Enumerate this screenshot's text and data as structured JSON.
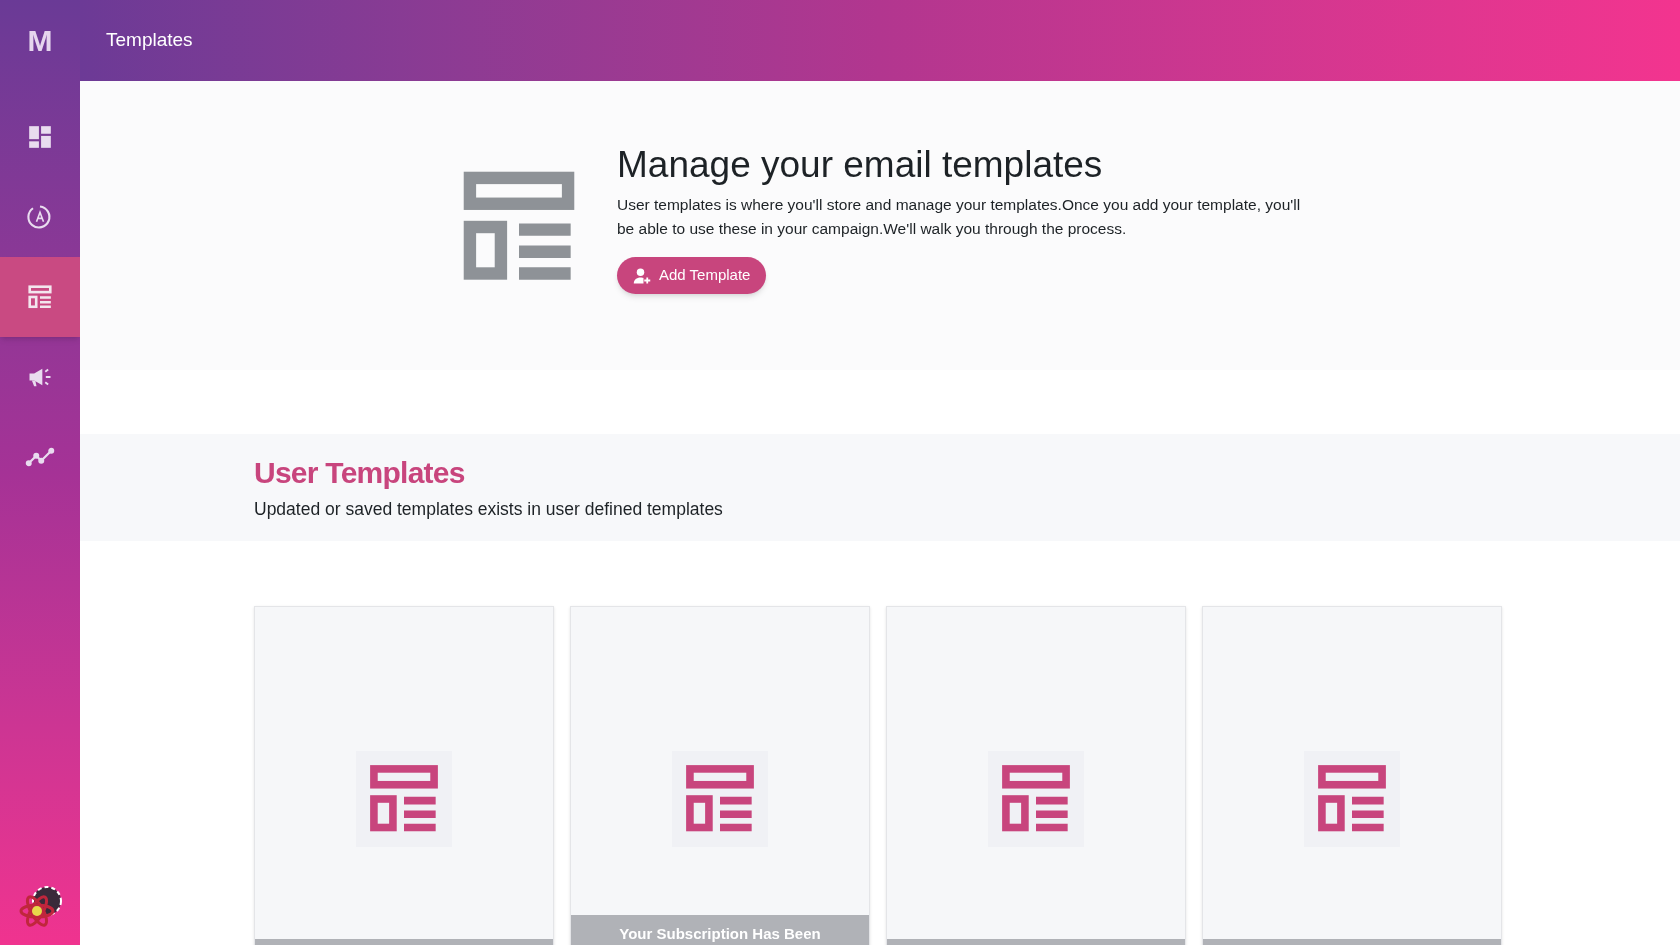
{
  "logo": "M",
  "header": {
    "title": "Templates"
  },
  "sidebar": {
    "items": [
      {
        "selected": false
      },
      {
        "selected": false
      },
      {
        "selected": true
      },
      {
        "selected": false
      },
      {
        "selected": false
      }
    ]
  },
  "hero": {
    "title": "Manage your email templates",
    "description": "User templates is where you'll store and manage your templates.Once you add your template, you'll be able to use these in your campaign.We'll walk you through the process.",
    "button": "Add Template"
  },
  "section": {
    "title": "User Templates",
    "subtitle": "Updated or saved templates exists in user defined templates"
  },
  "cards": [
    {
      "kind": "plain"
    },
    {
      "kind": "captioned",
      "caption": "Your Subscription Has Been"
    },
    {
      "kind": "plain"
    },
    {
      "kind": "plain"
    }
  ]
}
